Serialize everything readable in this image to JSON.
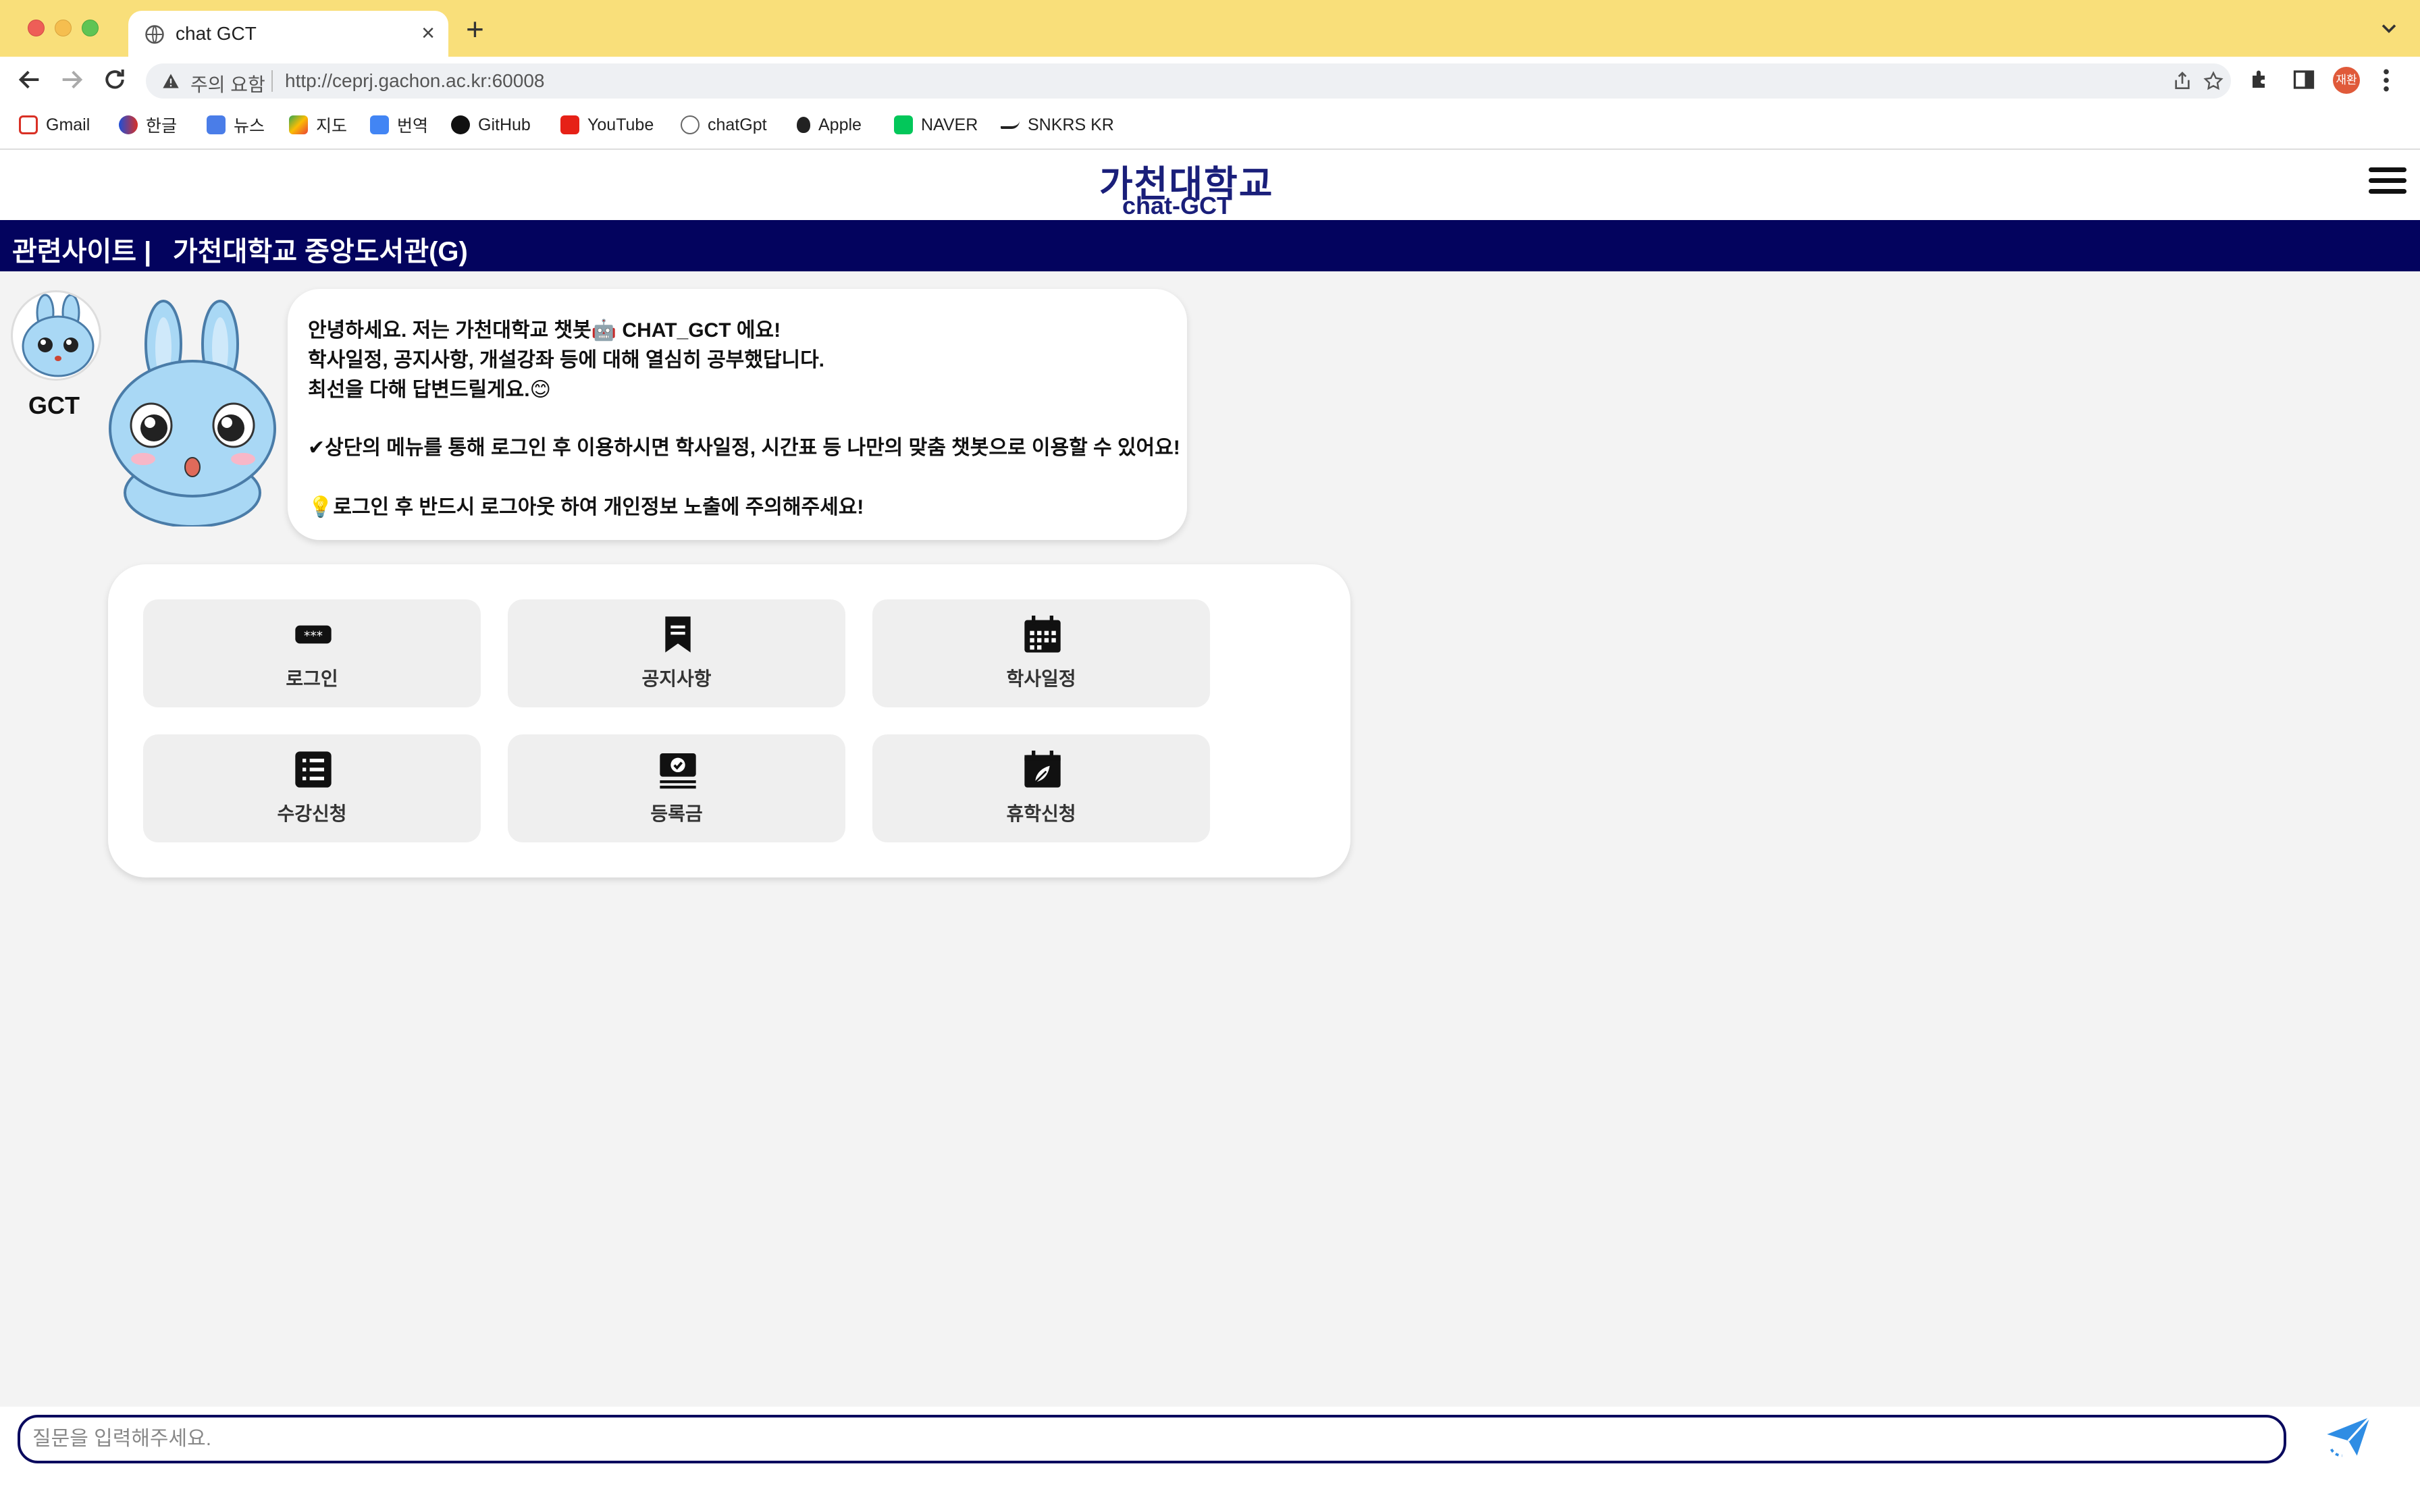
{
  "browser": {
    "tab_title": "chat GCT",
    "address_warning": "주의 요함",
    "url": "http://ceprj.gachon.ac.kr:60008",
    "profile_label": "재환",
    "bookmarks": [
      "Gmail",
      "한글",
      "뉴스",
      "지도",
      "번역",
      "GitHub",
      "YouTube",
      "chatGpt",
      "Apple",
      "NAVER",
      "SNKRS KR"
    ]
  },
  "header": {
    "logo_kr": "가천대학교",
    "logo_en": "chat-GCT"
  },
  "related": {
    "label": "관련사이트 |",
    "link": "가천대학교 중앙도서관(G)"
  },
  "bot": {
    "name": "GCT",
    "lines": [
      "안녕하세요. 저는 가천대학교 챗봇🤖 CHAT_GCT 에요!",
      "학사일정, 공지사항, 개설강좌 등에 대해 열심히 공부했답니다.",
      "최선을 다해 답변드릴게요.😊",
      "✔상단의 메뉴를 통해 로그인 후 이용하시면 학사일정, 시간표 등 나만의 맞춤 챗봇으로 이용할 수 있어요!",
      "💡로그인 후 반드시 로그아웃 하여 개인정보 노출에 주의해주세요!"
    ]
  },
  "menu": [
    {
      "label": "로그인",
      "icon": "password-icon"
    },
    {
      "label": "공지사항",
      "icon": "notice-icon"
    },
    {
      "label": "학사일정",
      "icon": "calendar-icon"
    },
    {
      "label": "수강신청",
      "icon": "list-icon"
    },
    {
      "label": "등록금",
      "icon": "money-icon"
    },
    {
      "label": "휴학신청",
      "icon": "leaf-calendar-icon"
    }
  ],
  "input": {
    "placeholder": "질문을 입력해주세요."
  },
  "colors": {
    "tabbar": "#f9df7a",
    "navy": "#03035e",
    "logo": "#1a1f7a",
    "send": "#2f8de4"
  }
}
